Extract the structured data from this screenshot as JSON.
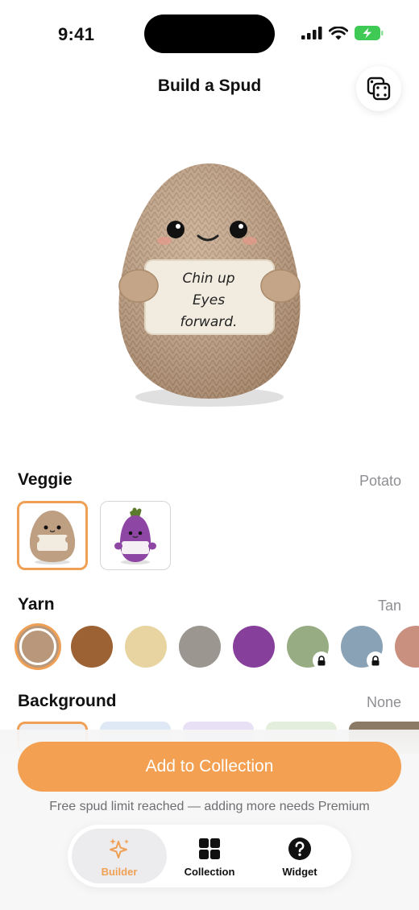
{
  "status_bar": {
    "time": "9:41"
  },
  "header": {
    "title": "Build a Spud",
    "randomize_icon": "dice-icon"
  },
  "hero": {
    "sign_lines": [
      "Chin up",
      "Eyes",
      "forward."
    ]
  },
  "veggie": {
    "label": "Veggie",
    "selected_value": "Potato",
    "options": [
      {
        "name": "potato",
        "selected": true
      },
      {
        "name": "eggplant",
        "selected": false
      }
    ]
  },
  "yarn": {
    "label": "Yarn",
    "selected_value": "Tan",
    "swatches": [
      {
        "color": "#b8977a",
        "selected": true,
        "locked": false
      },
      {
        "color": "#9c6233",
        "selected": false,
        "locked": false
      },
      {
        "color": "#e7d4a0",
        "selected": false,
        "locked": false
      },
      {
        "color": "#9b968f",
        "selected": false,
        "locked": false
      },
      {
        "color": "#86409c",
        "selected": false,
        "locked": false
      },
      {
        "color": "#98ac84",
        "selected": false,
        "locked": true
      },
      {
        "color": "#8aa2b5",
        "selected": false,
        "locked": true
      },
      {
        "color": "#c99080",
        "selected": false,
        "locked": false
      }
    ]
  },
  "background": {
    "label": "Background",
    "selected_value": "None",
    "tiles": [
      {
        "color": "#eceef2",
        "selected": true
      },
      {
        "color": "#dfe8f5",
        "selected": false
      },
      {
        "color": "#e8e0f5",
        "selected": false
      },
      {
        "color": "#e3efdc",
        "selected": false
      },
      {
        "color": "#8a7a66",
        "selected": false
      }
    ]
  },
  "cta": {
    "label": "Add to Collection",
    "note": "Free spud limit reached — adding more needs Premium"
  },
  "tabs": [
    {
      "label": "Builder",
      "icon": "sparkles-icon",
      "active": true
    },
    {
      "label": "Collection",
      "icon": "grid-icon",
      "active": false
    },
    {
      "label": "Widget",
      "icon": "question-circle-icon",
      "active": false
    }
  ],
  "colors": {
    "accent": "#f3a053",
    "secondary_text": "#8e8e93"
  }
}
